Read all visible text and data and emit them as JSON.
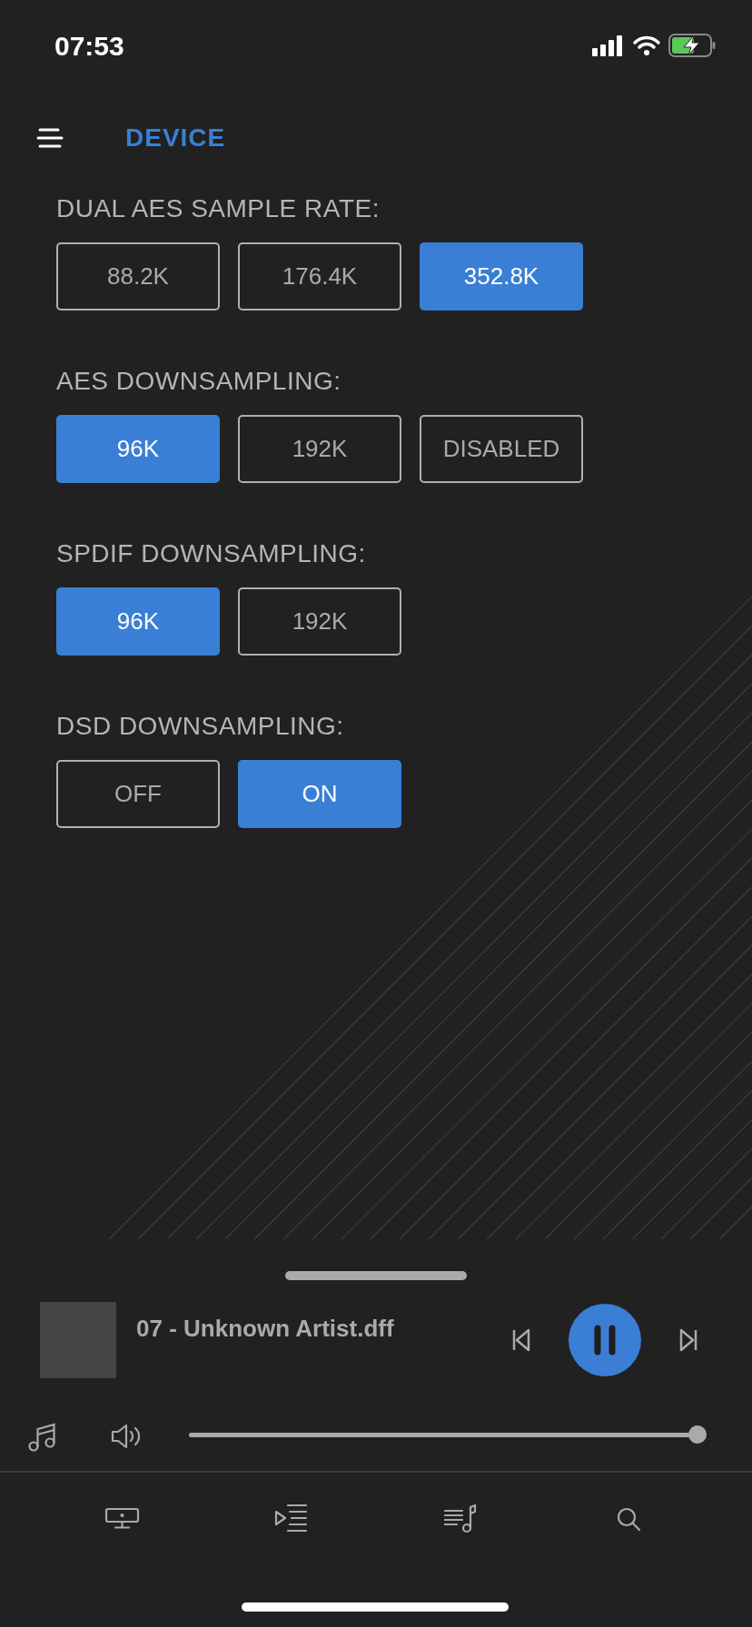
{
  "status_bar": {
    "time": "07:53"
  },
  "header": {
    "title": "DEVICE"
  },
  "sections": [
    {
      "label": "DUAL AES SAMPLE RATE:",
      "options": [
        {
          "label": "88.2K",
          "selected": false
        },
        {
          "label": "176.4K",
          "selected": false
        },
        {
          "label": "352.8K",
          "selected": true
        }
      ]
    },
    {
      "label": "AES DOWNSAMPLING:",
      "options": [
        {
          "label": "96K",
          "selected": true
        },
        {
          "label": "192K",
          "selected": false
        },
        {
          "label": "DISABLED",
          "selected": false
        }
      ]
    },
    {
      "label": "SPDIF DOWNSAMPLING:",
      "options": [
        {
          "label": "96K",
          "selected": true
        },
        {
          "label": "192K",
          "selected": false
        }
      ]
    },
    {
      "label": "DSD DOWNSAMPLING:",
      "options": [
        {
          "label": "OFF",
          "selected": false
        },
        {
          "label": "ON",
          "selected": true
        }
      ]
    }
  ],
  "player": {
    "track": "07 - Unknown Artist.dff",
    "playing": true,
    "volume": {
      "level": 1.0
    }
  }
}
